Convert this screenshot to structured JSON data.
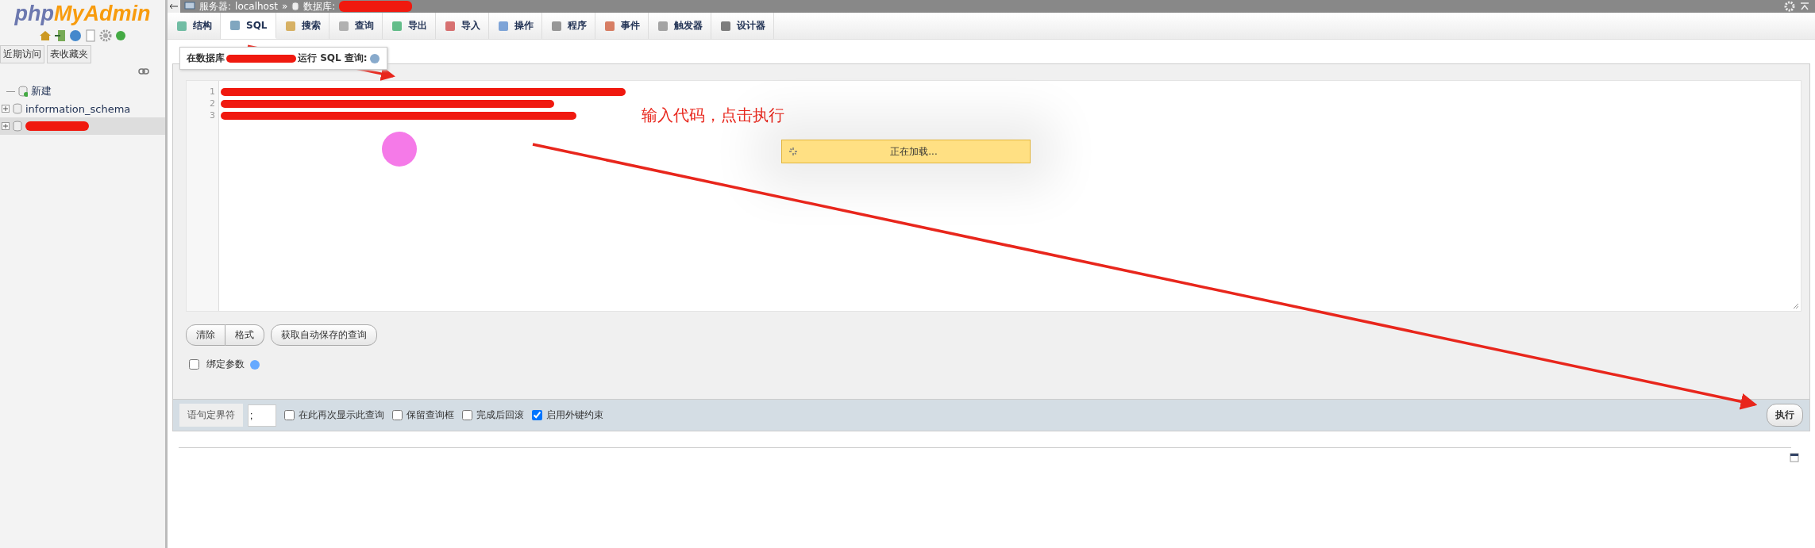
{
  "sidebar": {
    "logo": {
      "part_1": "php",
      "part_2": "MyAdmin"
    },
    "tabs": [
      {
        "label": "近期访问"
      },
      {
        "label": "表收藏夹"
      }
    ],
    "tree": [
      {
        "kind": "new",
        "label": "新建",
        "selected": false
      },
      {
        "kind": "database",
        "label": "information_schema",
        "selected": false
      },
      {
        "kind": "redacted",
        "selected": true
      }
    ]
  },
  "breadcrumb": {
    "server_label": "服务器:",
    "server": "localhost",
    "separator": "»",
    "database_label": "数据库:"
  },
  "tabs": [
    {
      "label": "结构",
      "selected": false
    },
    {
      "label": "SQL",
      "selected": true
    },
    {
      "label": "搜索",
      "selected": false
    },
    {
      "label": "查询",
      "selected": false
    },
    {
      "label": "导出",
      "selected": false
    },
    {
      "label": "导入",
      "selected": false
    },
    {
      "label": "操作",
      "selected": false
    },
    {
      "label": "程序",
      "selected": false
    },
    {
      "label": "事件",
      "selected": false
    },
    {
      "label": "触发器",
      "selected": false
    },
    {
      "label": "设计器",
      "selected": false
    }
  ],
  "query_box": {
    "legend_before": "在数据库",
    "legend_after": "运行 SQL 查询:",
    "line_numbers": [
      "1",
      "2",
      "3"
    ],
    "buttons": [
      "清除",
      "格式"
    ],
    "autosave_button": "获取自动保存的查询",
    "bind_parameters": {
      "label": "绑定参数",
      "checked": false
    }
  },
  "footer": {
    "delimiter_label": "语句定界符",
    "delimiter": ";",
    "options": [
      {
        "label": "在此再次显示此查询",
        "checked": false
      },
      {
        "label": "保留查询框",
        "checked": false
      },
      {
        "label": "完成后回滚",
        "checked": false
      },
      {
        "label": "启用外键约束",
        "checked": true
      }
    ],
    "go_button": "执行"
  },
  "annotation": {
    "note": "输入代码，点击执行",
    "loading": "正在加载..."
  }
}
